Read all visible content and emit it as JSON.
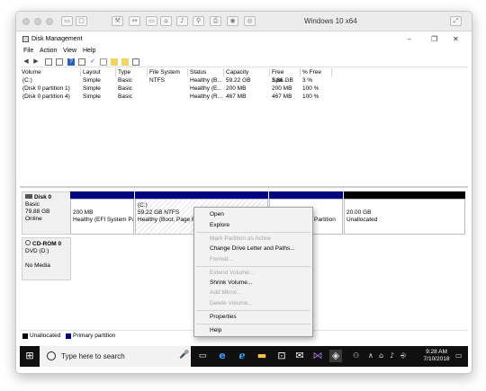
{
  "vm": {
    "title": "Windows 10 x64"
  },
  "app": {
    "title": "Disk Management",
    "menu": [
      "File",
      "Action",
      "View",
      "Help"
    ]
  },
  "volumes": {
    "columns": [
      "Volume",
      "Layout",
      "Type",
      "File System",
      "Status",
      "Capacity",
      "Free Spa...",
      "% Free"
    ],
    "rows": [
      [
        "(C:)",
        "Simple",
        "Basic",
        "NTFS",
        "Healthy (B...",
        "59.22 GB",
        "1.86 GB",
        "3 %"
      ],
      [
        "(Disk 0 partition 1)",
        "Simple",
        "Basic",
        "",
        "Healthy (E...",
        "200 MB",
        "200 MB",
        "100 %"
      ],
      [
        "(Disk 0 partition 4)",
        "Simple",
        "Basic",
        "",
        "Healthy (R...",
        "467 MB",
        "467 MB",
        "100 %"
      ]
    ]
  },
  "disks": {
    "disk0": {
      "name": "Disk 0",
      "type": "Basic",
      "size": "79.88 GB",
      "status": "Online",
      "partitions": [
        {
          "line1": "",
          "line2": "200 MB",
          "line3": "Healthy (EFI System Par"
        },
        {
          "line1": "(C:)",
          "line2": "59.22 GB NTFS",
          "line3": "Healthy (Boot, Page Fil"
        },
        {
          "line1": "",
          "line2": "",
          "line3": "y Partition"
        },
        {
          "line1": "",
          "line2": "20.00 GB",
          "line3": "Unallocated"
        }
      ]
    },
    "cdrom0": {
      "name": "CD-ROM 0",
      "type": "DVD (D:)",
      "status": "No Media"
    }
  },
  "legend": [
    "Unallocated",
    "Primary partition"
  ],
  "colors": {
    "primary": "#000080",
    "unallocated": "#000000",
    "taskbar": "#101010",
    "edge": "#1e88e5"
  },
  "context_menu": {
    "items": [
      {
        "label": "Open",
        "enabled": true
      },
      {
        "label": "Explore",
        "enabled": true
      },
      {
        "label": "Mark Partition as Active",
        "enabled": false
      },
      {
        "label": "Change Drive Letter and Paths...",
        "enabled": true
      },
      {
        "label": "Format...",
        "enabled": false
      },
      {
        "label": "Extend Volume...",
        "enabled": false
      },
      {
        "label": "Shrink Volume...",
        "enabled": true
      },
      {
        "label": "Add Mirror...",
        "enabled": false
      },
      {
        "label": "Delete Volume...",
        "enabled": false
      },
      {
        "label": "Properties",
        "enabled": true
      },
      {
        "label": "Help",
        "enabled": true
      }
    ]
  },
  "taskbar": {
    "search_placeholder": "Type here to search",
    "time": "9:28 AM",
    "date": "7/10/2018",
    "icons": [
      "windows-start-icon",
      "cortana-circle-icon",
      "microphone-icon",
      "task-view-icon",
      "edge-icon",
      "ie-icon",
      "file-explorer-icon",
      "store-icon",
      "mail-icon",
      "visual-studio-icon",
      "vmware-icon",
      "people-icon",
      "chevron-up-icon",
      "network-icon",
      "volume-icon",
      "notifications-icon"
    ]
  }
}
